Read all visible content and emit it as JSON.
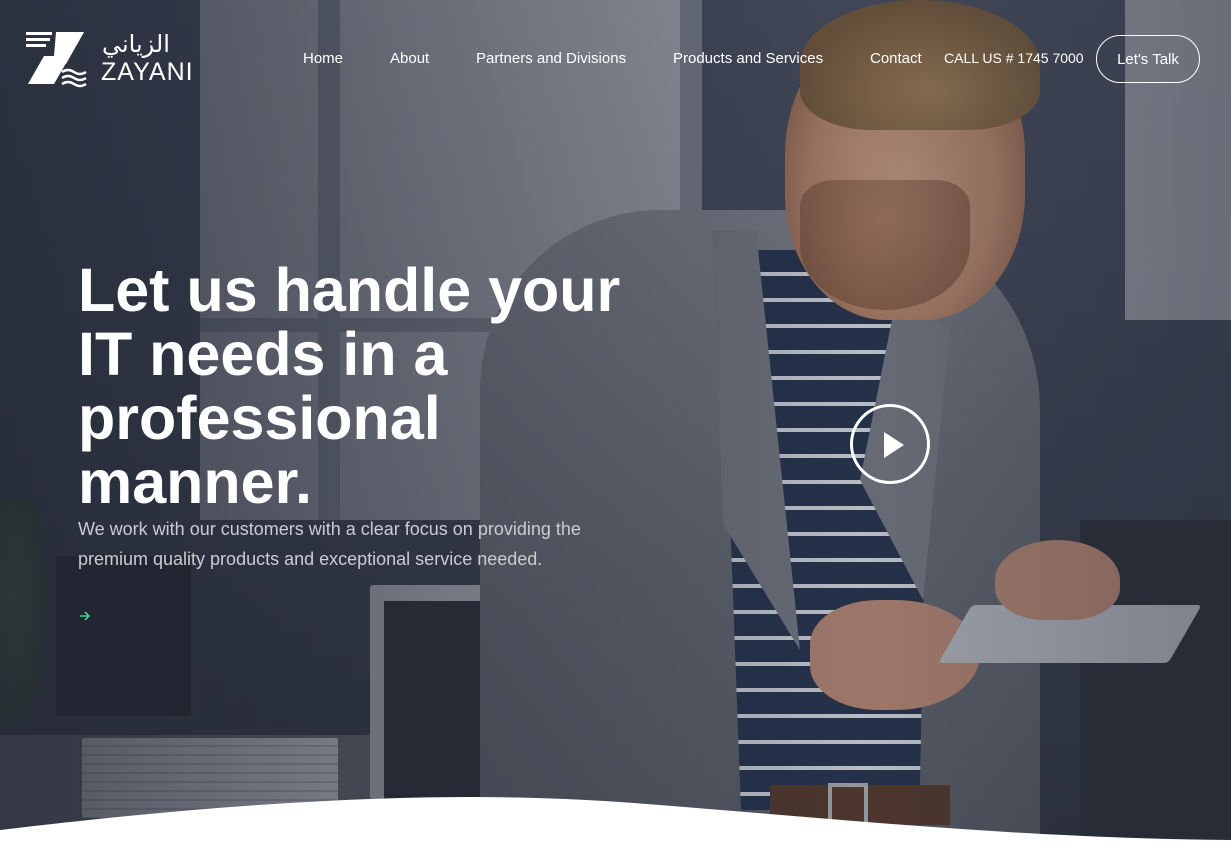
{
  "brand": {
    "arabic_name": "الزياني",
    "latin_name": "ZAYANI",
    "logo_icon": "zayani-z-logo"
  },
  "nav": {
    "items": [
      {
        "label": "Home"
      },
      {
        "label": "About"
      },
      {
        "label": "Partners and Divisions"
      },
      {
        "label": "Products and Services"
      },
      {
        "label": "Contact"
      }
    ],
    "call_text": "CALL US # 1745 7000",
    "cta_label": "Let's Talk"
  },
  "hero": {
    "headline": "Let us handle your IT needs in a professional manner.",
    "subtext": "We work with our customers with a clear focus on providing the premium quality products and exceptional service needed.",
    "arrow_icon": "arrow-right-icon",
    "play_icon": "play-icon"
  },
  "colors": {
    "accent": "#3fd08a",
    "text": "#ffffff",
    "subtext": "#c9ccd3"
  }
}
